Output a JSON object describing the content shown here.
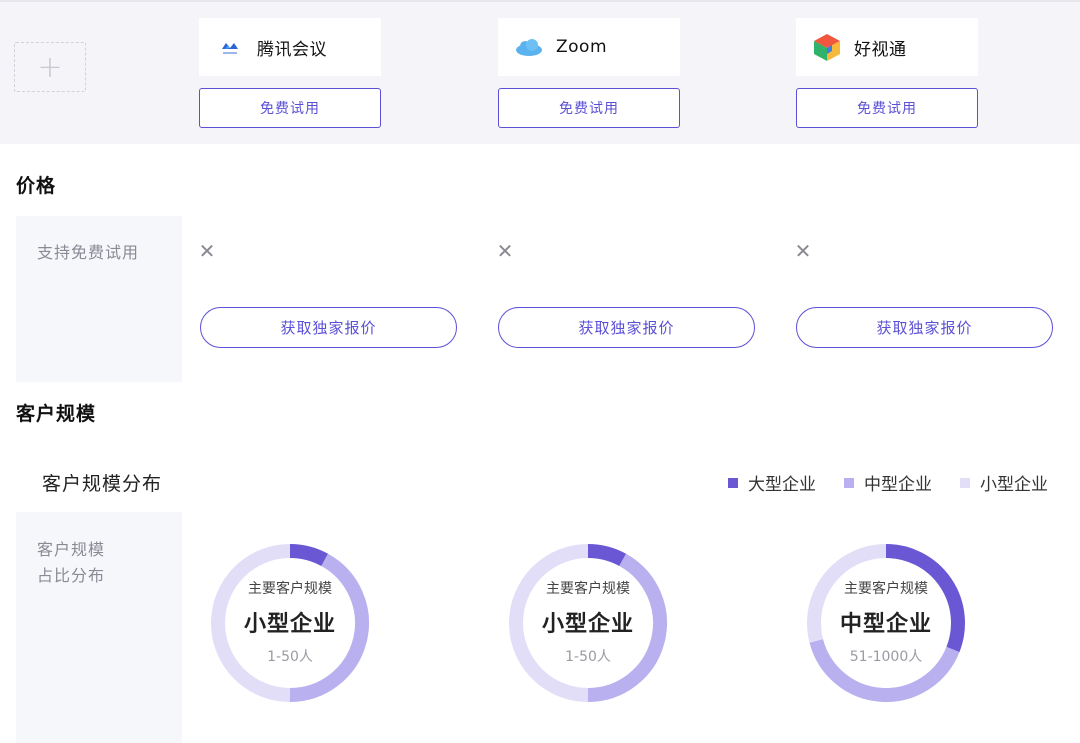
{
  "colors": {
    "accent": "#5b50d6",
    "large": "#6a57d4",
    "medium": "#b9b0ef",
    "small": "#e2def8"
  },
  "add_slot": {
    "icon": "+"
  },
  "products": [
    {
      "name": "腾讯会议",
      "logo_icon": "tencent-meeting-logo-icon",
      "trial_label": "免费试用"
    },
    {
      "name": "Zoom",
      "logo_icon": "zoom-cloud-logo-icon",
      "trial_label": "免费试用"
    },
    {
      "name": "好视通",
      "logo_icon": "haoshitong-cube-logo-icon",
      "trial_label": "免费试用"
    }
  ],
  "price_section": {
    "title": "价格",
    "row_label": "支持免费试用",
    "free_trial_values": [
      "✕",
      "✕",
      "✕"
    ],
    "quote_label": "获取独家报价"
  },
  "customer_section": {
    "title": "客户规模",
    "distribution_title": "客户规模分布",
    "row_label_line1": "客户规模",
    "row_label_line2": "占比分布",
    "legend": [
      {
        "name": "大型企业",
        "color": "#6a57d4"
      },
      {
        "name": "中型企业",
        "color": "#b9b0ef"
      },
      {
        "name": "小型企业",
        "color": "#e2def8"
      }
    ]
  },
  "chart_data": [
    {
      "type": "pie",
      "categories": [
        "大型企业",
        "中型企业",
        "小型企业"
      ],
      "values": [
        8,
        42,
        50
      ],
      "caption": "主要客户规模",
      "main": "小型企业",
      "range": "1-50人"
    },
    {
      "type": "pie",
      "categories": [
        "大型企业",
        "中型企业",
        "小型企业"
      ],
      "values": [
        8,
        42,
        50
      ],
      "caption": "主要客户规模",
      "main": "小型企业",
      "range": "1-50人"
    },
    {
      "type": "pie",
      "categories": [
        "大型企业",
        "中型企业",
        "小型企业"
      ],
      "values": [
        31,
        40,
        29
      ],
      "caption": "主要客户规模",
      "main": "中型企业",
      "range": "51-1000人"
    }
  ]
}
